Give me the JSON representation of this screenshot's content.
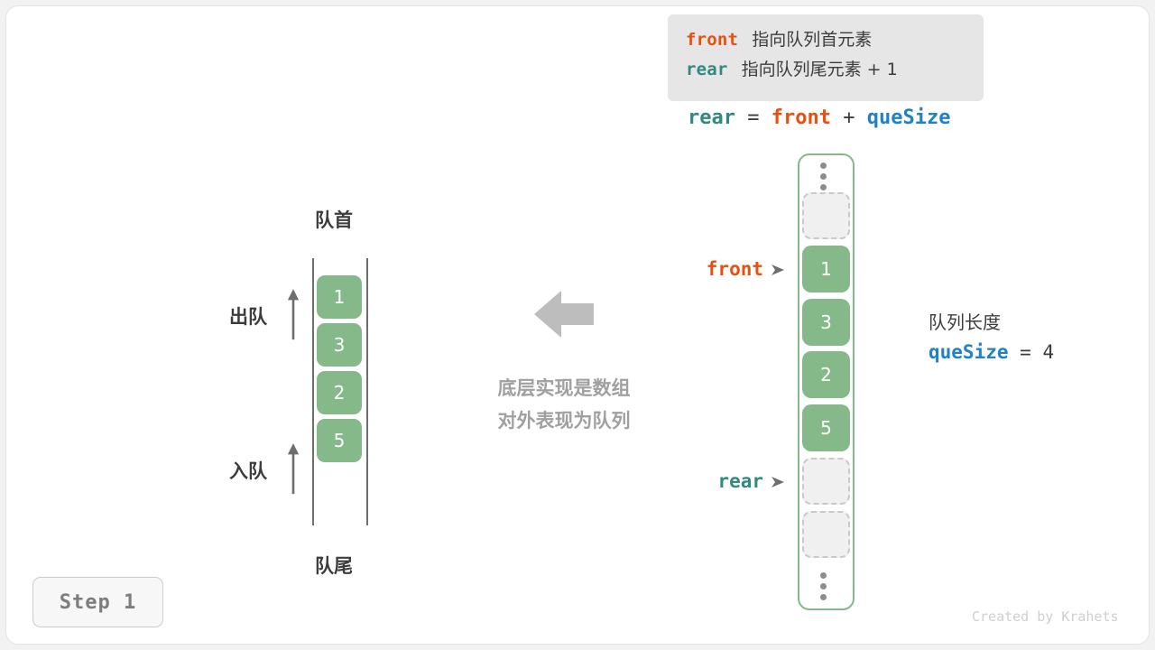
{
  "meta": {
    "step_label": "Step 1",
    "credit": "Created by Krahets"
  },
  "colors": {
    "front": "#e8500f",
    "rear": "#31897f",
    "quesize": "#2181c8",
    "cell_fill": "#85b989",
    "text_dark": "#3c3c3c",
    "muted": "#a0a0a0"
  },
  "info_box": {
    "line1": {
      "term": "front",
      "text": "指向队列首元素"
    },
    "line2": {
      "term": "rear",
      "text": "指向队列尾元素 + 1"
    }
  },
  "formula": {
    "lhs": "rear",
    "eq": "=",
    "rhs1": "front",
    "plus": "+",
    "rhs2": "queSize"
  },
  "logical_queue": {
    "head_label": "队首",
    "tail_label": "队尾",
    "dequeue_label": "出队",
    "enqueue_label": "入队",
    "cells": [
      "1",
      "3",
      "2",
      "5"
    ]
  },
  "middle": {
    "caption_line1": "底层实现是数组",
    "caption_line2": "对外表现为队列"
  },
  "array": {
    "top_ellipsis": "⋮",
    "bottom_ellipsis": "⋮",
    "slots": [
      {
        "value": "",
        "state": "empty"
      },
      {
        "value": "1",
        "state": "filled"
      },
      {
        "value": "3",
        "state": "filled"
      },
      {
        "value": "2",
        "state": "filled"
      },
      {
        "value": "5",
        "state": "filled"
      },
      {
        "value": "",
        "state": "empty"
      },
      {
        "value": "",
        "state": "empty"
      }
    ],
    "pointers": {
      "front": {
        "label": "front",
        "caret": "➤",
        "target_index": 1
      },
      "rear": {
        "label": "rear",
        "caret": "➤",
        "target_index": 5
      }
    }
  },
  "size_note": {
    "title": "队列长度",
    "var": "queSize",
    "eq": "=",
    "value": "4"
  }
}
